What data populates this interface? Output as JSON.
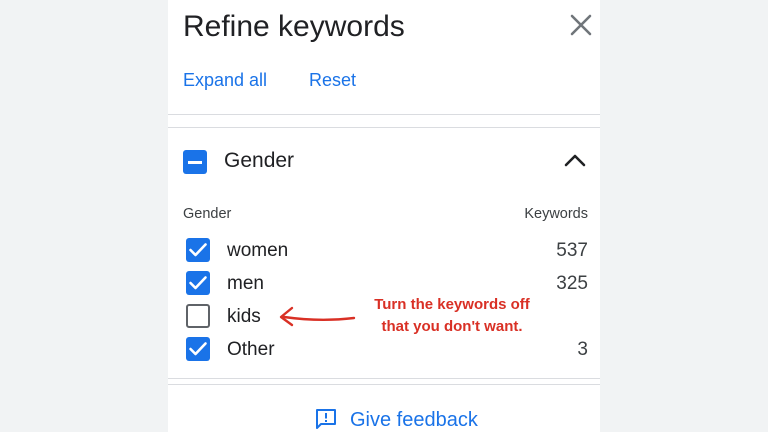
{
  "panel": {
    "title": "Refine keywords",
    "expand_all_label": "Expand all",
    "reset_label": "Reset"
  },
  "group": {
    "title": "Gender",
    "column_left": "Gender",
    "column_right": "Keywords",
    "rows": [
      {
        "label": "women",
        "count": "537",
        "checked": true
      },
      {
        "label": "men",
        "count": "325",
        "checked": true
      },
      {
        "label": "kids",
        "count": "",
        "checked": false
      },
      {
        "label": "Other",
        "count": "3",
        "checked": true
      }
    ]
  },
  "feedback": {
    "label": "Give feedback"
  },
  "annotation": {
    "line1": "Turn the keywords off",
    "line2": "that you don't want."
  },
  "colors": {
    "accent": "#1a73e8",
    "annotation": "#d93025",
    "background": "#f1f3f4"
  },
  "icons": {
    "close": "close-icon",
    "collapse": "chevron-up-icon",
    "feedback": "feedback-icon",
    "arrow": "arrow-left-icon"
  }
}
